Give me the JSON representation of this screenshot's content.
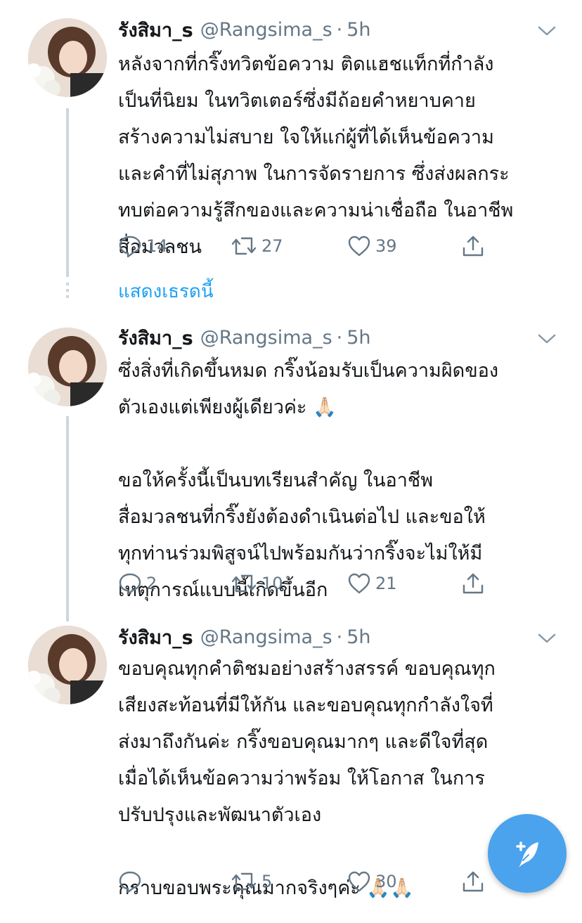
{
  "tweets": [
    {
      "name": "รังสิมา_s",
      "handle": "@Rangsima_s",
      "separator": "·",
      "time": "5h",
      "text": "หลังจากที่กริ๊งทวิตข้อความ ติดแฮชแท็กที่กำลัง\nเป็นที่นิยม ในทวิตเตอร์ซึ่งมีถ้อยคำหยาบคาย\nสร้างความไม่สบาย ใจให้แก่ผู้ที่ได้เห็นข้อความ\nและคำที่ไม่สุภาพ ในการจัดรายการ ซึ่งส่งผลกระ\nทบต่อความรู้สึกของและความน่าเชื่อถือ ในอาชีพ\nสื่อมวลชน",
      "replies": "14",
      "retweets": "27",
      "likes": "39"
    },
    {
      "name": "รังสิมา_s",
      "handle": "@Rangsima_s",
      "separator": "·",
      "time": "5h",
      "text": "ซึ่งสิ่งที่เกิดขึ้นหมด กริ๊งน้อมรับเป็นความผิดของ\nตัวเองแต่เพียงผู้เดียวค่ะ 🙏🏻\n\nขอให้ครั้งนี้เป็นบทเรียนสำคัญ ในอาชีพ\nสื่อมวลชนที่กริ๊งยังต้องดำเนินต่อไป และขอให้\nทุกท่านร่วมพิสูจน์ไปพร้อมกันว่ากริ๊งจะไม่ให้มี\nเหตุการณ์แบบนี้เกิดขึ้นอีก",
      "replies": "2",
      "retweets": "10",
      "likes": "21"
    },
    {
      "name": "รังสิมา_s",
      "handle": "@Rangsima_s",
      "separator": "·",
      "time": "5h",
      "text": "ขอบคุณทุกคำติชมอย่างสร้างสรรค์ ขอบคุณทุก\nเสียงสะท้อนที่มีให้กัน และขอบคุณทุกกำลังใจที่\nส่งมาถึงกันค่ะ กริ๊งขอบคุณมากๆ และดีใจที่สุด\nเมื่อได้เห็นข้อความว่าพร้อม ให้โอกาส ในการ\nปรับปรุงและพัฒนาตัวเอง\n\nกราบขอบพระคุณมากจริงๆค่ะ 🙏🏻🙏🏻",
      "replies": "",
      "retweets": "5",
      "likes": "30"
    }
  ],
  "show_thread_label": "แสดงเธรดนี้",
  "colors": {
    "accent": "#1da1f2",
    "fab": "#4aa3ec",
    "muted": "#657786",
    "line": "#ccd6dd"
  },
  "icons": [
    "reply-icon",
    "retweet-icon",
    "like-icon",
    "share-icon",
    "chevron-down-icon",
    "compose-tweet-icon"
  ]
}
